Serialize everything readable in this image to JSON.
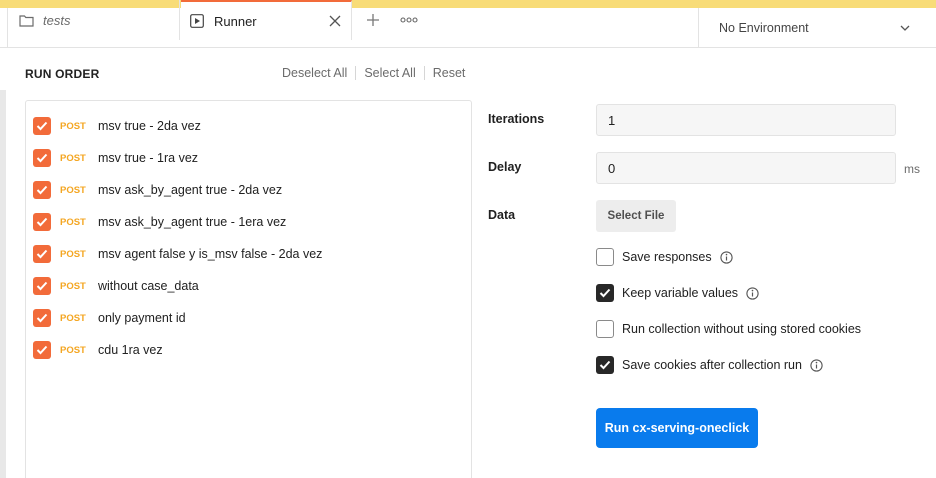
{
  "tabs": {
    "tests_label": "tests",
    "runner_label": "Runner"
  },
  "environment": {
    "selected": "No Environment"
  },
  "run_order": {
    "title": "RUN ORDER",
    "deselect_all": "Deselect All",
    "select_all": "Select All",
    "reset": "Reset",
    "requests": [
      {
        "method": "POST",
        "name": "msv true - 2da vez",
        "checked": true
      },
      {
        "method": "POST",
        "name": "msv true - 1ra vez",
        "checked": true
      },
      {
        "method": "POST",
        "name": "msv ask_by_agent true - 2da vez",
        "checked": true
      },
      {
        "method": "POST",
        "name": "msv ask_by_agent true - 1era vez",
        "checked": true
      },
      {
        "method": "POST",
        "name": "msv agent false y is_msv false - 2da vez",
        "checked": true
      },
      {
        "method": "POST",
        "name": "without case_data",
        "checked": true
      },
      {
        "method": "POST",
        "name": "only payment id",
        "checked": true
      },
      {
        "method": "POST",
        "name": "cdu 1ra vez",
        "checked": true
      }
    ]
  },
  "settings": {
    "iterations_label": "Iterations",
    "iterations_value": "1",
    "delay_label": "Delay",
    "delay_value": "0",
    "delay_unit": "ms",
    "data_label": "Data",
    "select_file": "Select File",
    "options": [
      {
        "label": "Save responses",
        "checked": false,
        "info": true
      },
      {
        "label": "Keep variable values",
        "checked": true,
        "info": true
      },
      {
        "label": "Run collection without using stored cookies",
        "checked": false,
        "info": false
      },
      {
        "label": "Save cookies after collection run",
        "checked": true,
        "info": true
      }
    ],
    "run_button": "Run cx-serving-oneclick"
  },
  "colors": {
    "accent_orange": "#f26b3a",
    "post_method": "#f4a622",
    "primary_blue": "#097bed",
    "top_strip": "#f8dc78"
  }
}
